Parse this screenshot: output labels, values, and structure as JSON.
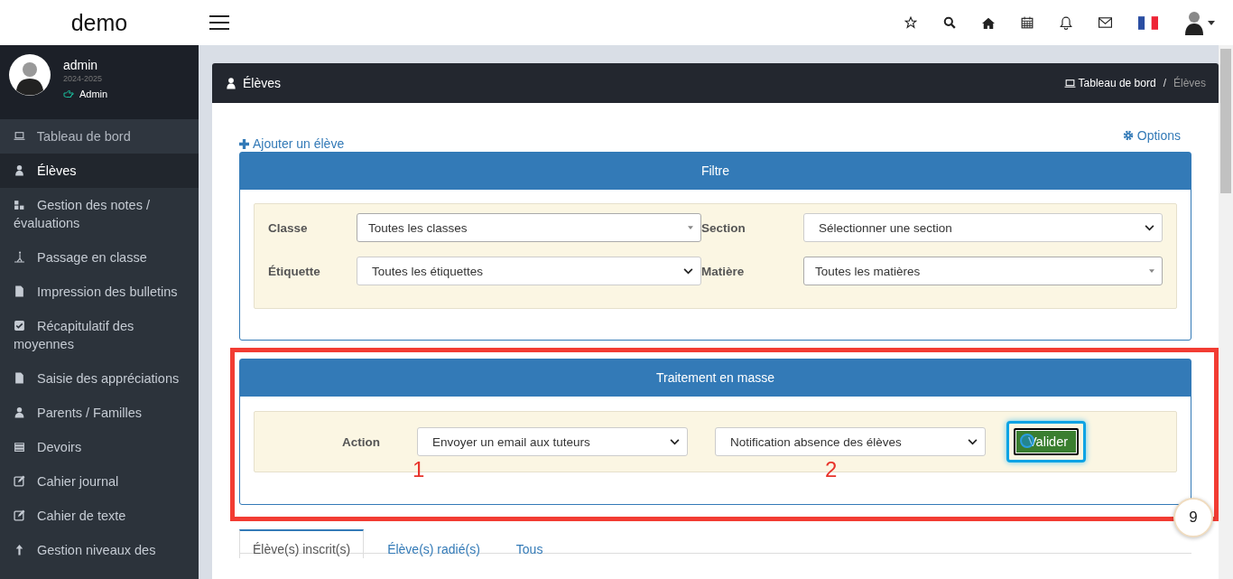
{
  "brand": "demo",
  "user": {
    "name": "admin",
    "year": "2024-2025",
    "role": "Admin"
  },
  "sidebar": {
    "items": [
      {
        "label": "Tableau de bord",
        "selected": false
      },
      {
        "label": "Élèves",
        "selected": true
      },
      {
        "label": "Gestion des notes / évaluations",
        "selected": false
      },
      {
        "label": "Passage en classe",
        "selected": false
      },
      {
        "label": "Impression des bulletins",
        "selected": false
      },
      {
        "label": "Récapitulatif des moyennes",
        "selected": false
      },
      {
        "label": "Saisie des appréciations",
        "selected": false
      },
      {
        "label": "Parents / Familles",
        "selected": false
      },
      {
        "label": "Devoirs",
        "selected": false
      },
      {
        "label": "Cahier journal",
        "selected": false
      },
      {
        "label": "Cahier de texte",
        "selected": false
      },
      {
        "label": "Gestion niveaux des",
        "selected": false
      }
    ]
  },
  "page": {
    "title": "Élèves",
    "breadcrumb": [
      "Tableau de bord",
      "/",
      "Élèves"
    ],
    "add_link": "Ajouter un élève",
    "options_link": "Options"
  },
  "filter": {
    "title": "Filtre",
    "fields": [
      {
        "label": "Classe",
        "value": "Toutes les classes",
        "kind": "combo"
      },
      {
        "label": "Section",
        "value": "Sélectionner une section",
        "kind": "select"
      },
      {
        "label": "Étiquette",
        "value": "Toutes les étiquettes",
        "kind": "select"
      },
      {
        "label": "Matière",
        "value": "Toutes les matières",
        "kind": "combo"
      }
    ]
  },
  "mass": {
    "title": "Traitement en masse",
    "label": "Action",
    "selects": [
      "Envoyer un email aux tuteurs",
      "Notification absence des élèves"
    ],
    "button": "Valider"
  },
  "tabs": [
    {
      "label": "Élève(s) inscrit(s)",
      "selected": true
    },
    {
      "label": "Élève(s) radié(s)",
      "selected": false
    },
    {
      "label": "Tous",
      "selected": false
    }
  ],
  "annotations": {
    "markers": [
      "1",
      "2"
    ],
    "step": "9"
  }
}
